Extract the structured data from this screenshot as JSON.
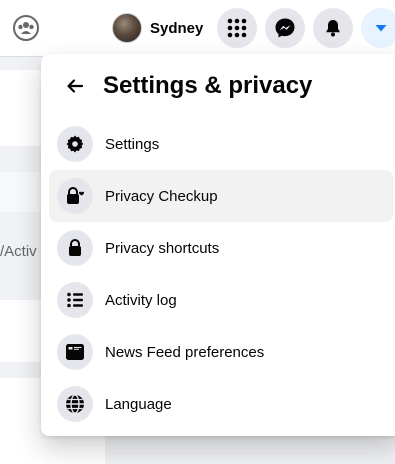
{
  "header": {
    "profile": {
      "name": "Sydney"
    },
    "icons": [
      "groups-icon",
      "menu-grid-icon",
      "messenger-icon",
      "notifications-bell-icon",
      "account-caret-down-icon"
    ]
  },
  "background": {
    "partial_text": "/Activ"
  },
  "panel": {
    "title": "Settings & privacy",
    "items": [
      {
        "label": "Settings",
        "icon": "gear-icon"
      },
      {
        "label": "Privacy Checkup",
        "icon": "lock-heart-icon"
      },
      {
        "label": "Privacy shortcuts",
        "icon": "lock-icon"
      },
      {
        "label": "Activity log",
        "icon": "list-icon"
      },
      {
        "label": "News Feed preferences",
        "icon": "feed-icon"
      },
      {
        "label": "Language",
        "icon": "globe-icon"
      }
    ]
  },
  "colors": {
    "accent": "#1877f2",
    "icon_bg": "#e4e6eb",
    "hover_bg": "#f2f2f2",
    "page_bg": "#f0f2f5"
  }
}
